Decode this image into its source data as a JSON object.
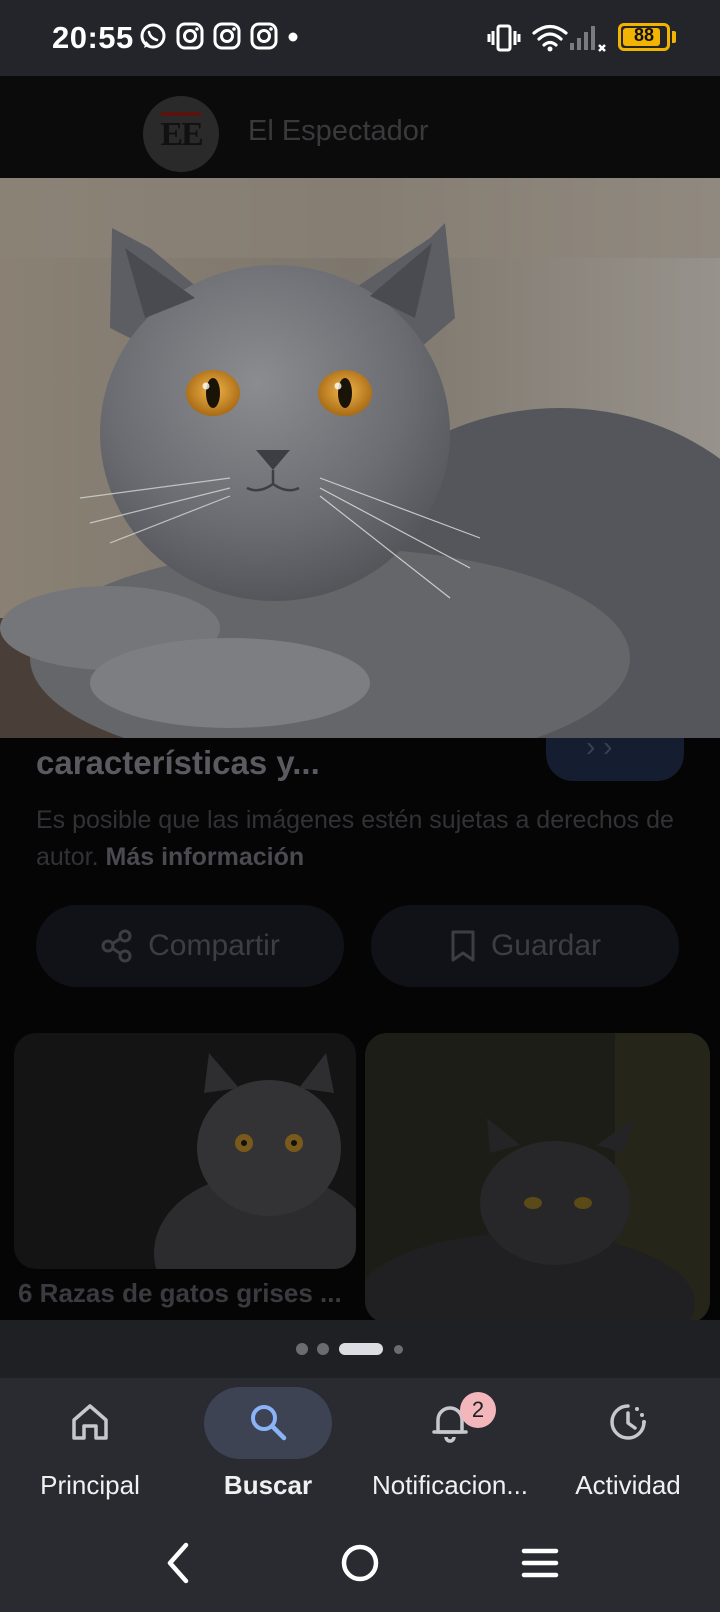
{
  "status_bar": {
    "time": "20:55",
    "battery_level": "88",
    "battery_fraction": 0.88,
    "icons": [
      "whatsapp-icon",
      "instagram-icon",
      "instagram-icon",
      "instagram-icon",
      "dot-icon",
      "vibrate-icon",
      "wifi-icon",
      "signal-icon"
    ]
  },
  "source": {
    "logo_text": "EE",
    "name": "El Espectador"
  },
  "result": {
    "title": "características y...",
    "rights_text": "Es posible que las imágenes estén sujetas a derechos de autor.",
    "rights_link": "Más información"
  },
  "actions": {
    "share_label": "Compartir",
    "save_label": "Guardar"
  },
  "related": {
    "caption": "6 Razas de gatos grises ..."
  },
  "pager": {
    "count": 4,
    "active_index": 2
  },
  "bottom_nav": {
    "items": [
      {
        "label": "Principal",
        "icon": "home-icon"
      },
      {
        "label": "Buscar",
        "icon": "search-icon"
      },
      {
        "label": "Notificacion...",
        "icon": "bell-icon",
        "badge": "2"
      },
      {
        "label": "Actividad",
        "icon": "history-icon"
      }
    ],
    "active_index": 1
  },
  "colors": {
    "accent": "#8ab4f8",
    "battery": "#f2b400",
    "nav_background": "#2a2b31",
    "badge": "#f3b7bb"
  }
}
